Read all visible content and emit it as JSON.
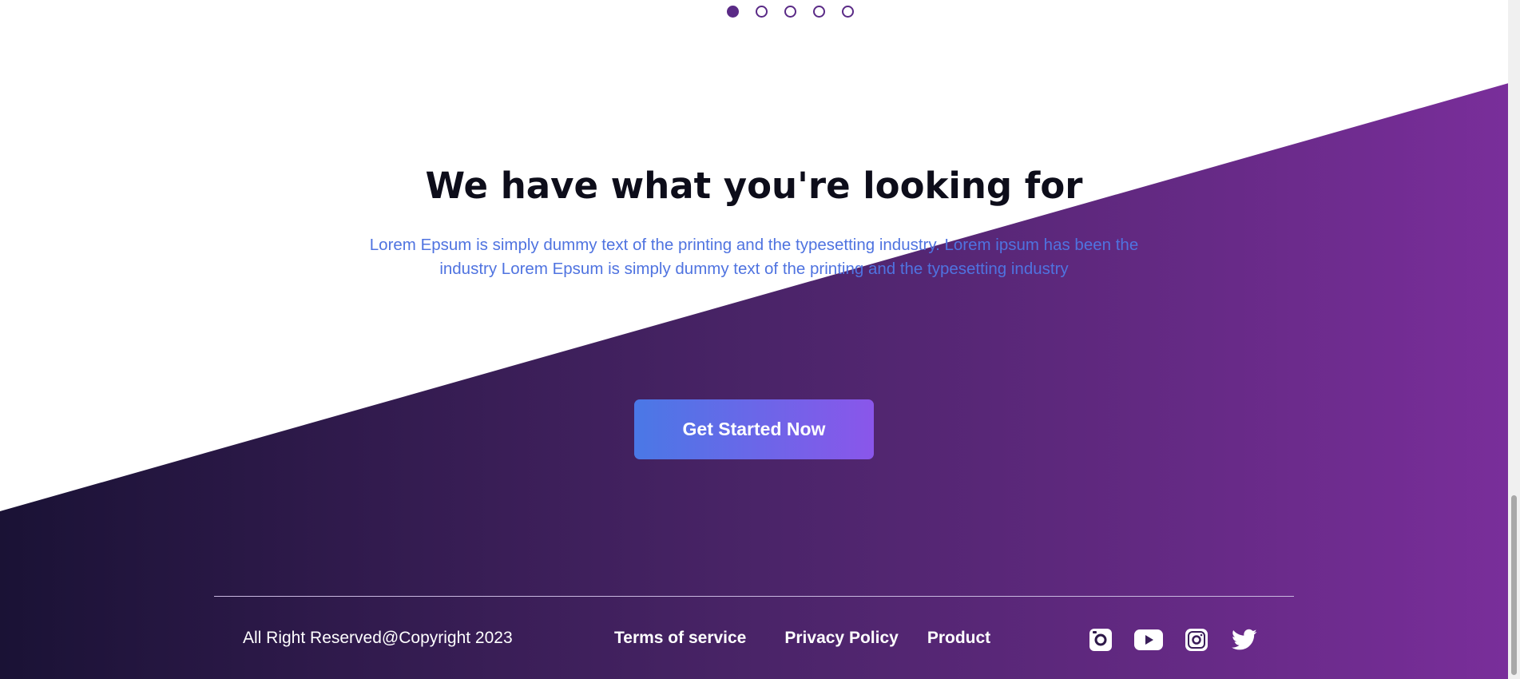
{
  "carousel": {
    "dot_count": 5,
    "active_index": 0
  },
  "hero": {
    "heading": "We have what you're looking for",
    "subtext": "Lorem Epsum is simply dummy text of the printing and the typesetting industry. Lorem ipsum has been the industry Lorem Epsum is simply dummy text of the printing and the typesetting industry",
    "cta_label": "Get Started Now"
  },
  "footer": {
    "copyright": "All Right Reserved@Copyright 2023",
    "links": [
      "Terms of service",
      "Privacy Policy",
      "Product"
    ],
    "socials": [
      "camera-icon",
      "youtube-icon",
      "instagram-icon",
      "twitter-icon"
    ]
  },
  "colors": {
    "gradient_start": "#1a1235",
    "gradient_end": "#7a2e9b",
    "cta_start": "#4a78e6",
    "cta_end": "#8a56ea",
    "subtext": "#4f73e0",
    "dot": "#5a2a86"
  }
}
